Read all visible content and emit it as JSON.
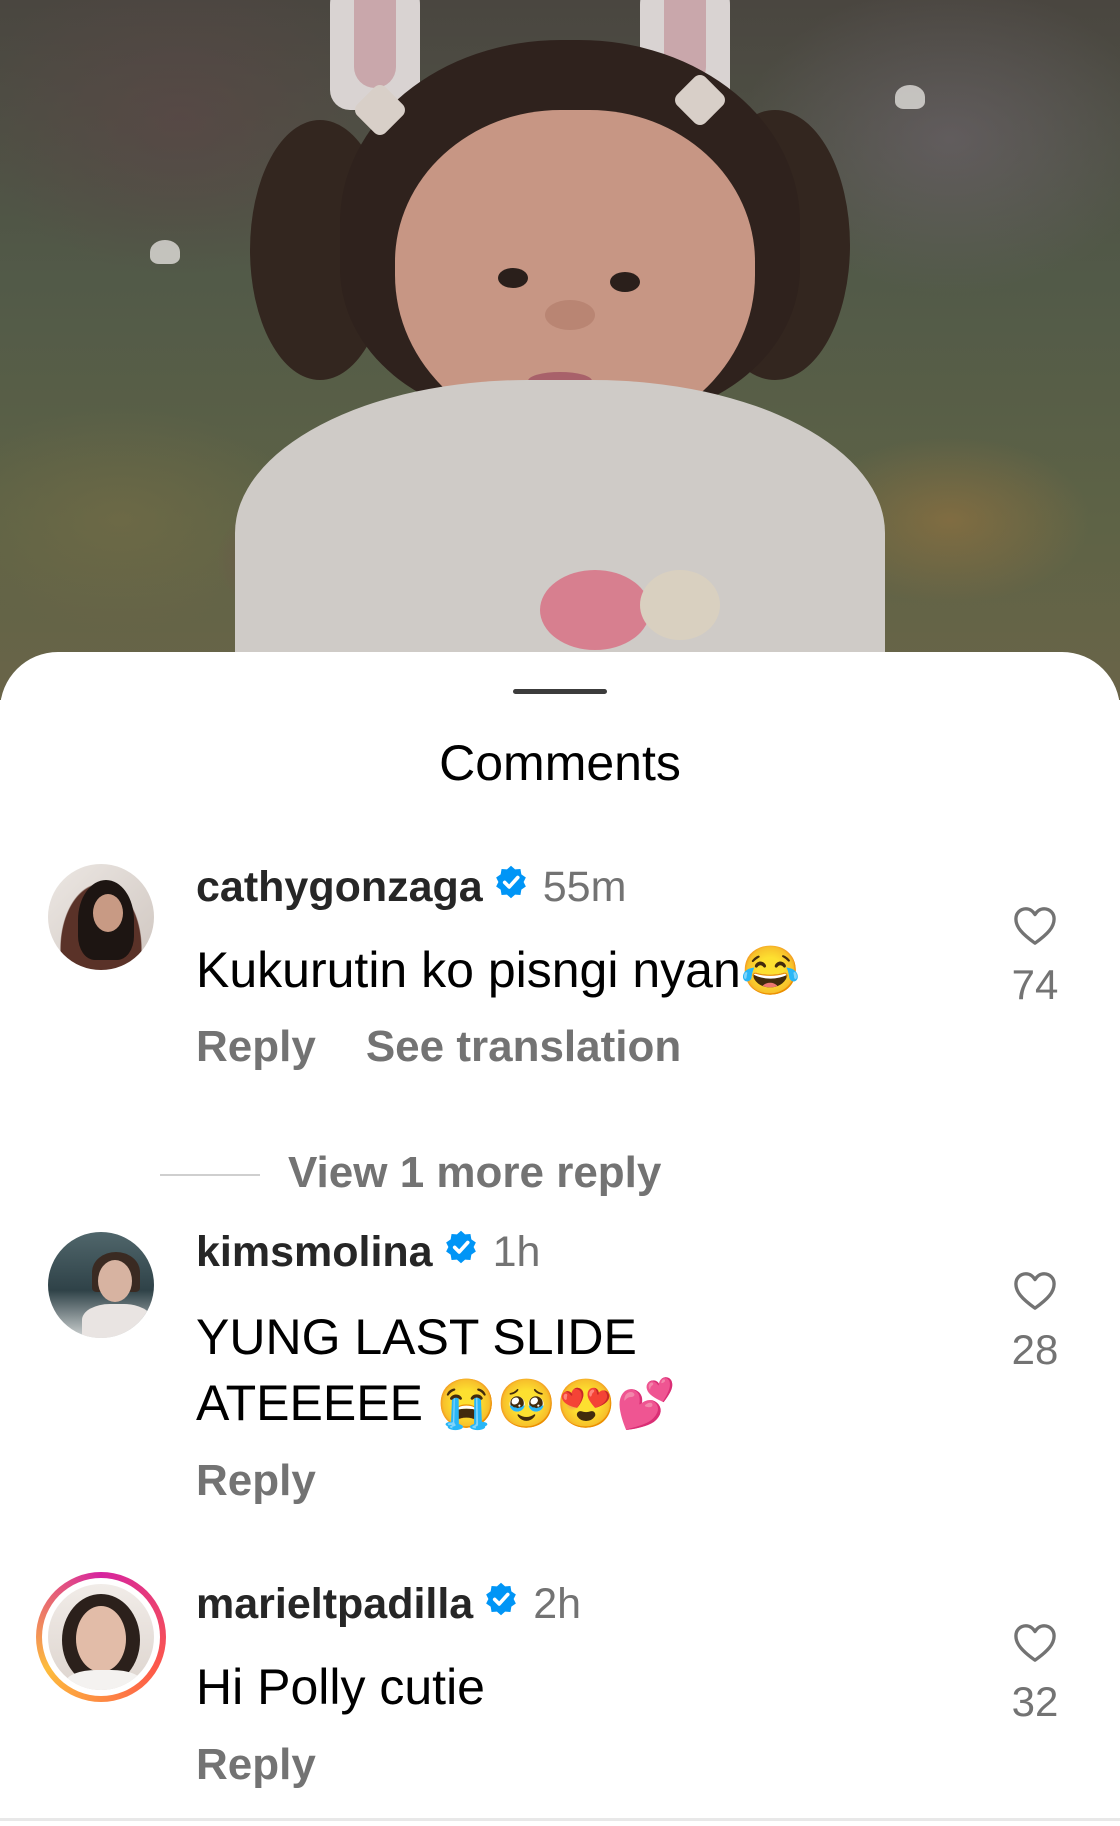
{
  "sheet": {
    "title": "Comments"
  },
  "comments": [
    {
      "username": "cathygonzaga",
      "verified": true,
      "time": "55m",
      "text": "Kukurutin ko pisngi nyan",
      "emoji": "😂",
      "reply_label": "Reply",
      "translate_label": "See translation",
      "likes": "74"
    },
    {
      "username": "kimsmolina",
      "verified": true,
      "time": "1h",
      "text_line1": "YUNG LAST SLIDE",
      "text_line2": "ATEEEEE",
      "emoji": "😭🥹😍💕",
      "reply_label": "Reply",
      "likes": "28"
    },
    {
      "username": "marieltpadilla",
      "verified": true,
      "time": "2h",
      "text": "Hi Polly cutie",
      "reply_label": "Reply",
      "likes": "32"
    }
  ],
  "view_more": {
    "label": "View 1 more reply"
  },
  "colors": {
    "verified": "#0095f6",
    "secondary_text": "#737373"
  },
  "icons": {
    "like": "heart-outline-icon",
    "verified": "verified-badge-icon"
  }
}
